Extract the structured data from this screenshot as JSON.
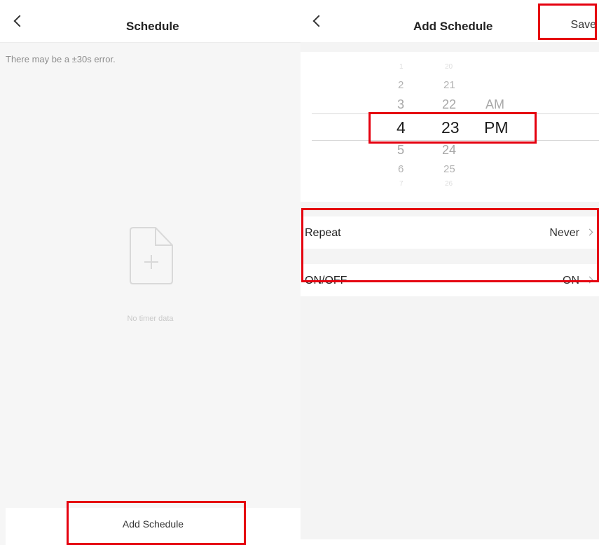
{
  "left_screen": {
    "title": "Schedule",
    "notice": "There may be a ±30s error.",
    "empty_icon": "file-add-icon",
    "empty_text": "No timer data",
    "add_button_label": "Add Schedule"
  },
  "right_screen": {
    "title": "Add Schedule",
    "save_label": "Save",
    "picker": {
      "hours": [
        "1",
        "2",
        "3",
        "4",
        "5",
        "6",
        "7"
      ],
      "minutes": [
        "20",
        "21",
        "22",
        "23",
        "24",
        "25",
        "26"
      ],
      "periods": [
        "AM",
        "PM"
      ],
      "selected_hour": "4",
      "selected_minute": "23",
      "selected_period": "PM"
    },
    "rows": [
      {
        "label": "Repeat",
        "value": "Never"
      },
      {
        "label": "ON/OFF",
        "value": "ON"
      }
    ]
  },
  "icons": {
    "back": "chevron-left-icon",
    "row_arrow": "chevron-right-icon"
  },
  "colors": {
    "highlight": "#e5000f",
    "page_background": "#f6f6f6",
    "selected_text": "#1b1b1b",
    "muted_text": "#bdbdbd"
  }
}
